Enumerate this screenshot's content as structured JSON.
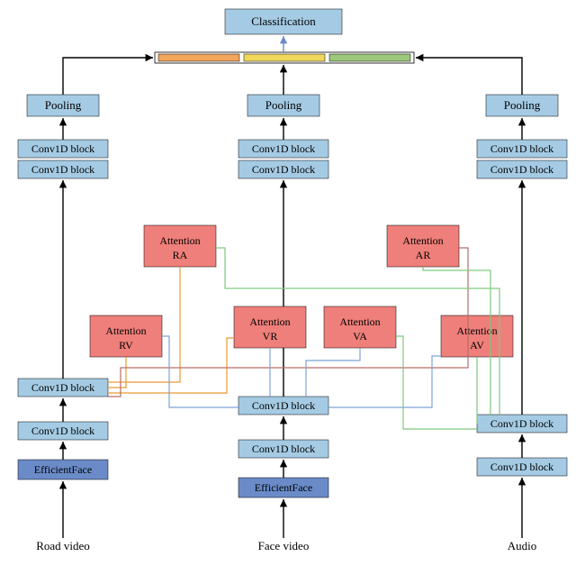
{
  "top": {
    "classification": "Classification"
  },
  "left": {
    "label": "Road video",
    "efficient": "EfficientFace",
    "conv1": "Conv1D block",
    "conv2": "Conv1D block",
    "conv3": "Conv1D block",
    "conv4": "Conv1D block",
    "pooling": "Pooling"
  },
  "mid": {
    "label": "Face video",
    "efficient": "EfficientFace",
    "conv1": "Conv1D block",
    "conv2": "Conv1D block",
    "conv3": "Conv1D block",
    "conv4": "Conv1D block",
    "pooling": "Pooling"
  },
  "right": {
    "label": "Audio",
    "conv1": "Conv1D block",
    "conv2": "Conv1D block",
    "conv3": "Conv1D block",
    "conv4": "Conv1D block",
    "pooling": "Pooling"
  },
  "attn": {
    "rv": {
      "l1": "Attention",
      "l2": "RV"
    },
    "ra": {
      "l1": "Attention",
      "l2": "RA"
    },
    "vr": {
      "l1": "Attention",
      "l2": "VR"
    },
    "va": {
      "l1": "Attention",
      "l2": "VA"
    },
    "av": {
      "l1": "Attention",
      "l2": "AV"
    },
    "ar": {
      "l1": "Attention",
      "l2": "AR"
    }
  },
  "chart_data": {
    "type": "diagram",
    "title": "Multimodal attention fusion architecture",
    "streams": [
      {
        "name": "Road video",
        "stages": [
          "EfficientFace",
          "Conv1D block",
          "Conv1D block",
          "Conv1D block",
          "Conv1D block",
          "Pooling"
        ]
      },
      {
        "name": "Face video",
        "stages": [
          "EfficientFace",
          "Conv1D block",
          "Conv1D block",
          "Conv1D block",
          "Conv1D block",
          "Pooling"
        ]
      },
      {
        "name": "Audio",
        "stages": [
          "Conv1D block",
          "Conv1D block",
          "Conv1D block",
          "Conv1D block",
          "Pooling"
        ]
      }
    ],
    "cross_attention": [
      {
        "name": "Attention RV",
        "query": "Road video",
        "key": "Face video"
      },
      {
        "name": "Attention RA",
        "query": "Road video",
        "key": "Audio"
      },
      {
        "name": "Attention VR",
        "query": "Face video",
        "key": "Road video"
      },
      {
        "name": "Attention VA",
        "query": "Face video",
        "key": "Audio"
      },
      {
        "name": "Attention AV",
        "query": "Audio",
        "key": "Face video"
      },
      {
        "name": "Attention AR",
        "query": "Audio",
        "key": "Road video"
      }
    ],
    "fusion": "concat pooled features (3 segments) → Classification"
  }
}
